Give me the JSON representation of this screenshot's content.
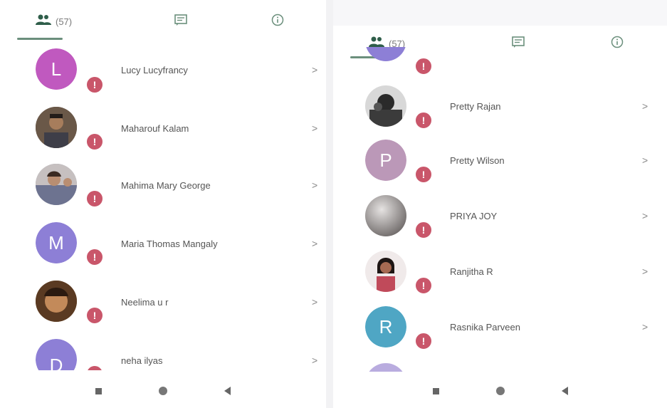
{
  "left_screen": {
    "tabs": {
      "members_count": "(57)"
    },
    "members": [
      {
        "name": "Lucy Lucyfrancy",
        "avatar_letter": "L",
        "avatar_color": "#c059bf",
        "badge": "!"
      },
      {
        "name": "Maharouf Kalam",
        "avatar_letter": "",
        "avatar_color": "#5a4a3e",
        "badge": "!"
      },
      {
        "name": "Mahima Mary George",
        "avatar_letter": "",
        "avatar_color": "#8e8fa3",
        "badge": "!"
      },
      {
        "name": "Maria Thomas Mangaly",
        "avatar_letter": "M",
        "avatar_color": "#8d7fd6",
        "badge": "!"
      },
      {
        "name": "Neelima u r",
        "avatar_letter": "",
        "avatar_color": "#9c7040",
        "badge": "!"
      },
      {
        "name": "neha ilyas",
        "avatar_letter": "D",
        "avatar_color": "#8d7fd6",
        "badge": "!"
      }
    ]
  },
  "right_screen": {
    "tabs": {
      "members_count": "(57)"
    },
    "members": [
      {
        "name": "Pretty Rajan",
        "avatar_letter": "",
        "avatar_color": "#3f3c39",
        "badge": "!"
      },
      {
        "name": "Pretty Wilson",
        "avatar_letter": "P",
        "avatar_color": "#bb98b8",
        "badge": "!"
      },
      {
        "name": "PRIYA JOY",
        "avatar_letter": "",
        "avatar_color": "#aca7a6",
        "badge": "!"
      },
      {
        "name": "Ranjitha R",
        "avatar_letter": "",
        "avatar_color": "#6a3f3a",
        "badge": "!"
      },
      {
        "name": "Rasnika Parveen",
        "avatar_letter": "R",
        "avatar_color": "#4fa6c4",
        "badge": "!"
      }
    ]
  },
  "icons": {
    "members_tab": "group-icon",
    "chat_tab": "message-icon",
    "info_tab": "info-icon",
    "chevron": ">",
    "nav_recent": "square-icon",
    "nav_home": "circle-icon",
    "nav_back": "triangle-back-icon"
  },
  "colors": {
    "tab_indicator": "#6b8f7c",
    "badge": "#c9566a"
  }
}
